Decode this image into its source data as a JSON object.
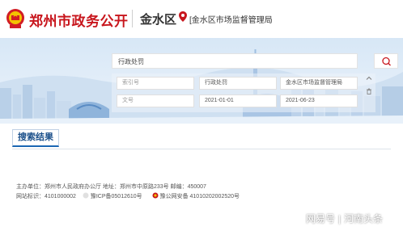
{
  "header": {
    "site_title": "郑州市政务公开",
    "district": "金水区",
    "department": "[金水区市场监督管理局"
  },
  "search": {
    "query": "行政处罚"
  },
  "filters": {
    "index_placeholder": "索引号",
    "category": "行政处罚",
    "publisher": "金水区市场监督管理局",
    "doc_no_placeholder": "文号",
    "date_from": "2021-01-01",
    "date_to": "2021-06-23"
  },
  "results": {
    "tab_label": "搜索结果"
  },
  "footer": {
    "line1": "主办单位：郑州市人民政府办公厅   地址：郑州市中原路233号   邮编：450007",
    "site_id": "网站标识：4101000002",
    "icp": "豫ICP备05012610号",
    "police": "豫公网安备 41010202002520号"
  },
  "watermark": {
    "left": "网易号",
    "right": "河南头条"
  },
  "colors": {
    "brand_red": "#c8161d",
    "accent_blue": "#1a66b3",
    "banner_sky": "#d7e7f6"
  }
}
